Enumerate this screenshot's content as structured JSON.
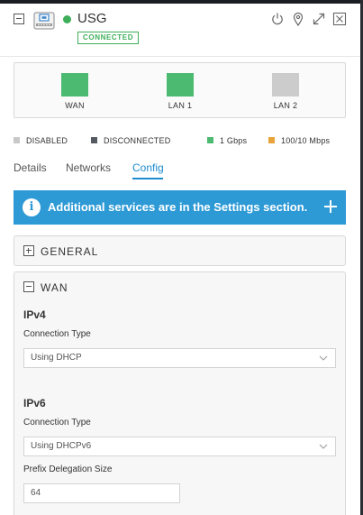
{
  "header": {
    "device_name": "USG",
    "status": "CONNECTED",
    "colors": {
      "status": "#3fae5a"
    },
    "icons": [
      "collapse-icon",
      "gateway-device-icon",
      "power-icon",
      "location-pin-icon",
      "expand-icon",
      "close-icon"
    ]
  },
  "ports": [
    {
      "label": "WAN",
      "color": "#4dba72"
    },
    {
      "label": "LAN 1",
      "color": "#4dba72"
    },
    {
      "label": "LAN 2",
      "color": "#cccccc"
    }
  ],
  "legend": [
    {
      "label": "DISABLED",
      "color": "#c8c8c8"
    },
    {
      "label": "DISCONNECTED",
      "color": "#555a60"
    },
    {
      "label": "1 Gbps",
      "color": "#4dba72"
    },
    {
      "label": "100/10 Mbps",
      "color": "#e8a33a"
    }
  ],
  "tabs": [
    {
      "label": "Details",
      "active": false
    },
    {
      "label": "Networks",
      "active": false
    },
    {
      "label": "Config",
      "active": true
    }
  ],
  "banner": {
    "text": "Additional services are in the Settings section.",
    "color": "#2d9ad6"
  },
  "sections": {
    "general": {
      "title": "GENERAL",
      "expanded": false
    },
    "wan": {
      "title": "WAN",
      "expanded": true,
      "ipv4": {
        "heading": "IPv4",
        "connection_type_label": "Connection Type",
        "connection_type_value": "Using DHCP"
      },
      "ipv6": {
        "heading": "IPv6",
        "connection_type_label": "Connection Type",
        "connection_type_value": "Using DHCPv6",
        "prefix_label": "Prefix Delegation Size",
        "prefix_value": "64"
      }
    }
  }
}
